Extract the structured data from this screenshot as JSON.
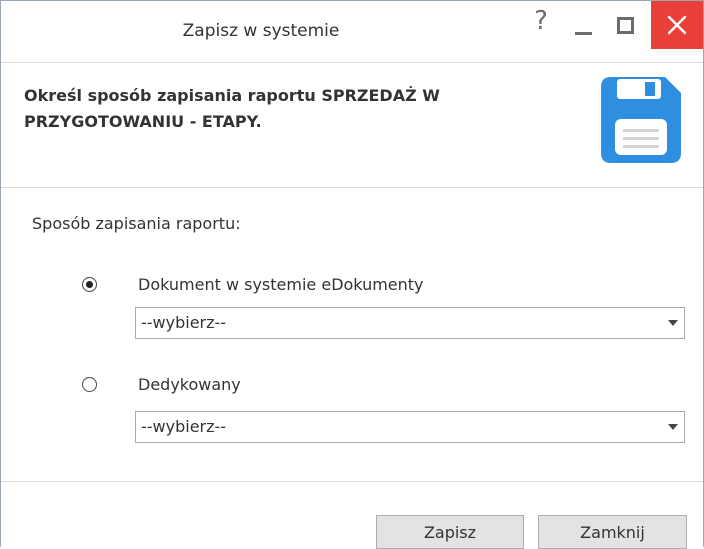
{
  "window": {
    "title": "Zapisz w systemie",
    "help_glyph": "?"
  },
  "colors": {
    "close_button": "#e9413a",
    "save_icon": "#2e8fe0",
    "button_face": "#e3e3e3"
  },
  "icons": {
    "help": "help-icon",
    "minimize": "minimize-icon",
    "maximize": "maximize-icon",
    "close": "close-icon",
    "header": "floppy-disk-icon"
  },
  "header": {
    "text": "Określ sposób zapisania raportu SPRZEDAŻ W PRZYGOTOWANIU - ETAPY."
  },
  "form": {
    "section_label": "Sposób zapisania raportu:",
    "options": [
      {
        "label": "Dokument w systemie eDokumenty",
        "checked": true,
        "select_value": "--wybierz--"
      },
      {
        "label": "Dedykowany",
        "checked": false,
        "select_value": "--wybierz--"
      }
    ]
  },
  "footer": {
    "save_label": "Zapisz",
    "close_label": "Zamknij"
  }
}
